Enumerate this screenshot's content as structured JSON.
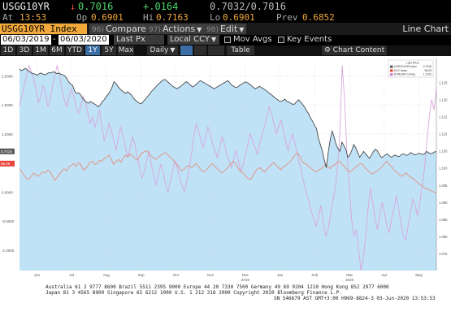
{
  "quote": {
    "ticker": "USGG10YR",
    "arrow": "↓",
    "last": "0.7016",
    "change": "+.0164",
    "bid_ask": "0.7032/0.7016",
    "at_label": "At",
    "time": "13:53",
    "open_label": "Op",
    "open": "0.6901",
    "high_label": "Hi",
    "high": "0.7163",
    "low_label": "Lo",
    "low": "0.6901",
    "prev_label": "Prev",
    "prev": "0.6852"
  },
  "toolbar": {
    "security": "USGG10YR Index",
    "compare_num": "96)",
    "compare": "Compare",
    "actions_num": "97)",
    "actions": "Actions",
    "edit_num": "98)",
    "edit": "Edit",
    "title": "Line Chart"
  },
  "settings": {
    "start_date": "06/03/2019",
    "end_date": "06/03/2020",
    "field": "Last Px",
    "currency": "Local CCY",
    "mov_avgs": "Mov Avgs",
    "key_events": "Key Events"
  },
  "periods": {
    "items": [
      "1D",
      "3D",
      "1M",
      "6M",
      "YTD",
      "1Y",
      "5Y",
      "Max"
    ],
    "active": "1Y",
    "frequency": "Daily",
    "table": "Table",
    "chart_content": "Chart Content"
  },
  "chart_data": {
    "type": "line",
    "legend": {
      "header": "Last Price",
      "placement": "top-right",
      "entries": [
        {
          "name": "USGG10YR Index",
          "value": "0.7016",
          "color": "#5a5a5a"
        },
        {
          "name": "DXY Index",
          "value": "98.09",
          "color": "#e8453c"
        },
        {
          "name": "EURUSD Curncy",
          "value": "1.1222",
          "color": "#d07ad0"
        }
      ]
    },
    "x_labels": [
      "Jun",
      "Jul",
      "Aug",
      "Sep",
      "Oct",
      "Nov",
      "Dec",
      "Jan",
      "Feb",
      "Mar",
      "Apr",
      "May"
    ],
    "year_labels": [
      {
        "after": "Dec",
        "text": "2019"
      },
      {
        "after": "Mar",
        "text": "2020"
      }
    ],
    "left_axis_ticks": [
      "2.0000",
      "1.5000",
      "1.0000",
      "0.5000",
      "0.0000",
      "-0.5000",
      "-1.0000"
    ],
    "right_axis_ticks": [
      "1.125",
      "1.120",
      "1.115",
      "1.110",
      "1.105",
      "1.100",
      "1.095",
      "1.090",
      "1.085",
      "1.080",
      "1.075"
    ],
    "last_value_tags": [
      {
        "text": "0.7016",
        "color": "#5a5a5a"
      },
      {
        "text": "98.09",
        "color": "#e8453c"
      }
    ],
    "series": [
      {
        "name": "USGG10YR Index",
        "fill": "#bfe2f7",
        "values": [
          2.12,
          2.09,
          2.11,
          2.13,
          2.1,
          2.08,
          2.05,
          2.04,
          2.03,
          2.01,
          2.04,
          2.05,
          2.03,
          2.02,
          2.04,
          2.06,
          2.05,
          2.07,
          2.06,
          2.04,
          2.05,
          2.03,
          2.02,
          2.0,
          1.96,
          1.9,
          1.86,
          1.84,
          1.74,
          1.7,
          1.71,
          1.68,
          1.62,
          1.58,
          1.55,
          1.53,
          1.56,
          1.54,
          1.52,
          1.5,
          1.47,
          1.5,
          1.55,
          1.59,
          1.64,
          1.68,
          1.73,
          1.8,
          1.9,
          1.87,
          1.82,
          1.78,
          1.75,
          1.72,
          1.7,
          1.73,
          1.7,
          1.67,
          1.62,
          1.58,
          1.55,
          1.53,
          1.52,
          1.56,
          1.6,
          1.64,
          1.68,
          1.73,
          1.76,
          1.8,
          1.84,
          1.87,
          1.9,
          1.93,
          1.94,
          1.91,
          1.88,
          1.85,
          1.82,
          1.8,
          1.78,
          1.8,
          1.82,
          1.85,
          1.88,
          1.9,
          1.87,
          1.84,
          1.81,
          1.83,
          1.86,
          1.89,
          1.92,
          1.9,
          1.88,
          1.86,
          1.84,
          1.82,
          1.8,
          1.78,
          1.8,
          1.82,
          1.84,
          1.86,
          1.88,
          1.9,
          1.92,
          1.88,
          1.84,
          1.82,
          1.8,
          1.81,
          1.84,
          1.86,
          1.88,
          1.9,
          1.88,
          1.86,
          1.83,
          1.8,
          1.78,
          1.8,
          1.82,
          1.8,
          1.78,
          1.76,
          1.73,
          1.7,
          1.68,
          1.65,
          1.62,
          1.6,
          1.57,
          1.56,
          1.58,
          1.6,
          1.56,
          1.55,
          1.53,
          1.51,
          1.52,
          1.56,
          1.59,
          1.55,
          1.51,
          1.46,
          1.4,
          1.35,
          1.28,
          1.22,
          1.15,
          1.1,
          0.93,
          0.82,
          0.71,
          0.55,
          0.42,
          0.68,
          0.9,
          1.05,
          0.95,
          0.82,
          0.75,
          0.7,
          0.86,
          0.8,
          0.73,
          0.6,
          0.64,
          0.72,
          0.82,
          0.76,
          0.68,
          0.6,
          0.65,
          0.7,
          0.66,
          0.62,
          0.58,
          0.64,
          0.7,
          0.74,
          0.71,
          0.65,
          0.6,
          0.61,
          0.64,
          0.66,
          0.63,
          0.6,
          0.62,
          0.64,
          0.62,
          0.61,
          0.64,
          0.66,
          0.65,
          0.63,
          0.65,
          0.68,
          0.66,
          0.64,
          0.65,
          0.67,
          0.66,
          0.65,
          0.66,
          0.7,
          0.68,
          0.66,
          0.67,
          0.69,
          0.7
        ]
      },
      {
        "name": "DXY Index",
        "values": [
          97.6,
          97.3,
          97.0,
          96.7,
          96.6,
          96.9,
          97.2,
          97.0,
          96.9,
          97.1,
          97.3,
          97.2,
          97.5,
          97.3,
          96.9,
          96.5,
          96.8,
          97.1,
          97.4,
          97.6,
          97.4,
          97.8,
          97.9,
          98.1,
          97.8,
          98.2,
          98.0,
          97.5,
          97.6,
          97.9,
          98.2,
          98.3,
          98.0,
          98.1,
          98.4,
          98.3,
          98.6,
          98.7,
          98.9,
          98.5,
          98.0,
          98.3,
          98.5,
          98.2,
          98.6,
          98.9,
          98.7,
          99.0,
          98.8,
          98.6,
          98.4,
          98.8,
          99.1,
          99.2,
          99.3,
          99.0,
          98.8,
          98.6,
          98.5,
          98.7,
          98.9,
          99.0,
          99.1,
          98.9,
          98.7,
          98.5,
          98.2,
          98.0,
          97.6,
          97.4,
          97.6,
          97.8,
          97.9,
          97.7,
          97.9,
          98.1,
          97.8,
          97.5,
          97.3,
          97.4,
          97.7,
          97.9,
          98.1,
          97.8,
          97.6,
          97.4,
          97.2,
          97.4,
          97.6,
          97.9,
          98.1,
          98.3,
          98.0,
          97.6,
          97.3,
          97.2,
          96.9,
          96.7,
          96.6,
          96.9,
          97.3,
          97.6,
          97.7,
          97.5,
          97.3,
          97.5,
          97.8,
          98.0,
          98.2,
          97.9,
          97.7,
          97.5,
          97.8,
          97.9,
          98.1,
          98.3,
          98.6,
          98.9,
          99.1,
          98.8,
          98.3,
          98.1,
          98.0,
          97.8,
          97.6,
          97.4,
          97.3,
          97.5,
          97.6,
          97.8,
          98.0,
          97.8,
          97.6,
          97.9,
          98.0,
          98.2,
          98.3,
          98.0,
          97.8,
          97.5,
          97.3,
          97.4,
          97.6,
          97.8,
          98.0,
          98.1,
          97.9,
          97.6,
          97.4,
          97.2,
          97.1,
          97.3,
          97.4,
          97.6,
          97.8,
          98.1,
          98.3,
          98.0,
          97.8,
          97.5,
          97.3,
          97.1,
          96.9,
          97.0,
          97.2,
          97.0,
          96.8,
          96.7,
          96.5,
          96.3,
          96.1,
          96.0,
          95.8,
          95.7,
          95.6,
          95.5,
          95.4,
          95.3
        ]
      },
      {
        "name": "EURUSD Curncy",
        "values": [
          1.118,
          1.121,
          1.124,
          1.127,
          1.13,
          1.128,
          1.126,
          1.123,
          1.119,
          1.121,
          1.124,
          1.122,
          1.118,
          1.12,
          1.124,
          1.127,
          1.13,
          1.127,
          1.123,
          1.12,
          1.118,
          1.121,
          1.123,
          1.121,
          1.118,
          1.116,
          1.118,
          1.121,
          1.119,
          1.116,
          1.113,
          1.115,
          1.112,
          1.114,
          1.117,
          1.112,
          1.108,
          1.11,
          1.113,
          1.111,
          1.108,
          1.105,
          1.109,
          1.112,
          1.109,
          1.106,
          1.103,
          1.106,
          1.109,
          1.107,
          1.103,
          1.1,
          1.097,
          1.099,
          1.102,
          1.105,
          1.101,
          1.098,
          1.095,
          1.098,
          1.101,
          1.099,
          1.095,
          1.093,
          1.096,
          1.099,
          1.102,
          1.1,
          1.097,
          1.095,
          1.093,
          1.096,
          1.1,
          1.104,
          1.109,
          1.113,
          1.111,
          1.108,
          1.106,
          1.109,
          1.112,
          1.11,
          1.107,
          1.105,
          1.103,
          1.106,
          1.109,
          1.107,
          1.104,
          1.102,
          1.1,
          1.103,
          1.105,
          1.102,
          1.099,
          1.101,
          1.104,
          1.107,
          1.11,
          1.108,
          1.106,
          1.104,
          1.107,
          1.11,
          1.112,
          1.115,
          1.118,
          1.116,
          1.113,
          1.11,
          1.112,
          1.114,
          1.111,
          1.108,
          1.105,
          1.108,
          1.11,
          1.107,
          1.104,
          1.101,
          1.098,
          1.095,
          1.092,
          1.09,
          1.087,
          1.085,
          1.083,
          1.086,
          1.089,
          1.084,
          1.08,
          1.082,
          1.086,
          1.09,
          1.094,
          1.1,
          1.11,
          1.13,
          1.12,
          1.105,
          1.095,
          1.085,
          1.08,
          1.082,
          1.076,
          1.07,
          1.074,
          1.08,
          1.088,
          1.094,
          1.09,
          1.085,
          1.082,
          1.086,
          1.09,
          1.087,
          1.083,
          1.081,
          1.085,
          1.088,
          1.092,
          1.088,
          1.084,
          1.08,
          1.079,
          1.083,
          1.087,
          1.091,
          1.089,
          1.086,
          1.09,
          1.095,
          1.1,
          1.108,
          1.115,
          1.12,
          1.117,
          1.123
        ]
      }
    ]
  },
  "footer": {
    "line1": "Australia 61 2 9777 8600  Brazil 5511 2395 9000  Europe 44 20 7330 7500  Germany 49 69 9204 1210  Hong Kong 852 2977 6000",
    "line2": "Japan 81 3 4565 8900         Singapore 65 6212 1000          U.S. 1 212 318 2000          Copyright 2020 Bloomberg Finance L.P.",
    "line3": "SN 546679 AST  GMT+3:00 H969-8824-3 03-Jun-2020 13:53:53"
  }
}
